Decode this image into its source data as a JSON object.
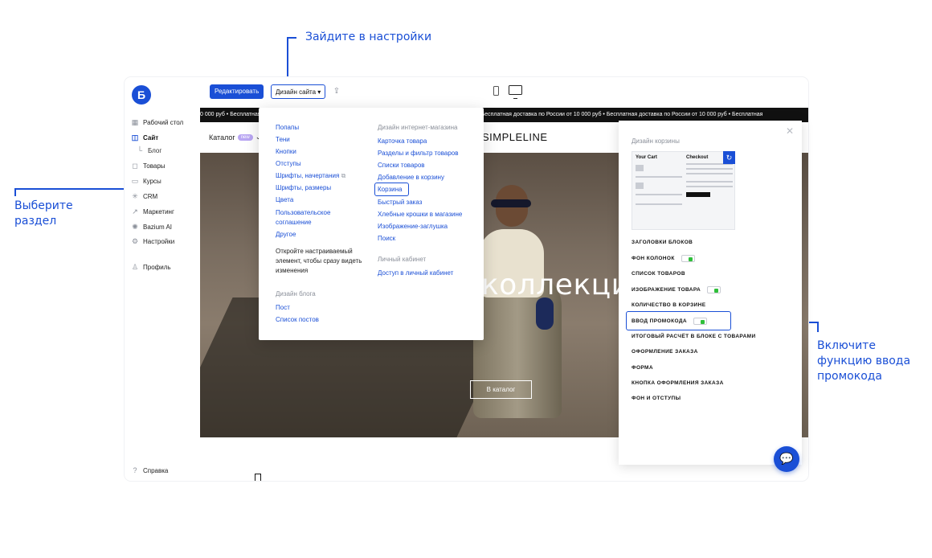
{
  "annotations": {
    "top": "Зайдите в настройки",
    "left": "Выберите раздел",
    "right": "Включите функцию ввода промокода"
  },
  "sidebar": {
    "logo": "Б",
    "items": [
      {
        "label": "Рабочий стол",
        "icon": "grid-icon"
      },
      {
        "label": "Сайт",
        "icon": "layout-icon"
      },
      {
        "label": "Блог",
        "icon": "corner-icon"
      },
      {
        "label": "Товары",
        "icon": "bag-icon"
      },
      {
        "label": "Курсы",
        "icon": "book-icon"
      },
      {
        "label": "CRM",
        "icon": "network-icon"
      },
      {
        "label": "Маркетинг",
        "icon": "chart-icon"
      },
      {
        "label": "Bazium AI",
        "icon": "sparkle-icon"
      },
      {
        "label": "Настройки",
        "icon": "gear-icon"
      },
      {
        "label": "Профиль",
        "icon": "user-icon"
      },
      {
        "label": "Справка",
        "icon": "help-icon"
      }
    ]
  },
  "toolbar": {
    "edit_label": "Редактировать",
    "design_label": "Дизайн сайта ▾"
  },
  "site": {
    "ticker": "0 000 руб   •   Бесплатная доставка по России от 10 000 руб   •   Бесплатная доставка по России от 10 000 руб   •   Бесплатная доставка по России от 10 000 руб   •   Бесплатная доставка по России от 10 000 руб   •   Бесплатная",
    "catalog": "Каталог",
    "badge": "new",
    "brand": "SIMPLELINE",
    "hero_title": "коллекция",
    "hero_button": "В каталог"
  },
  "dropdown": {
    "col1": [
      "Попапы",
      "Тени",
      "Кнопки",
      "Отступы",
      "Шрифты, начертания",
      "Шрифты, размеры",
      "Цвета",
      "Пользовательское соглашение",
      "Другое"
    ],
    "hint": "Откройте настраиваемый элемент, чтобы сразу видеть изменения",
    "blog_head": "Дизайн блога",
    "blog_items": [
      "Пост",
      "Список постов"
    ],
    "shop_head": "Дизайн интернет-магазина",
    "shop_items": [
      "Карточка товара",
      "Разделы и фильтр товаров",
      "Списки товаров",
      "Добавление в корзину",
      "Корзина",
      "Быстрый заказ",
      "Хлебные крошки в магазине",
      "Изображение-заглушка",
      "Поиск"
    ],
    "account_head": "Личный кабинет",
    "account_items": [
      "Доступ в личный кабинет"
    ]
  },
  "panel": {
    "title": "Дизайн корзины",
    "thumb_left": "Your Cart",
    "thumb_right": "Checkout",
    "rows": [
      {
        "label": "ЗАГОЛОВКИ БЛОКОВ",
        "toggle": false
      },
      {
        "label": "ФОН КОЛОНОК",
        "toggle": true
      },
      {
        "label": "СПИСОК ТОВАРОВ",
        "toggle": false
      },
      {
        "label": "ИЗОБРАЖЕНИЕ ТОВАРА",
        "toggle": true
      },
      {
        "label": "КОЛИЧЕСТВО В КОРЗИНЕ",
        "toggle": false
      },
      {
        "label": "ВВОД ПРОМОКОДА",
        "toggle": true
      },
      {
        "label": "ИТОГОВЫЙ РАСЧЁТ В БЛОКЕ С ТОВАРАМИ",
        "toggle": false
      },
      {
        "label": "ОФОРМЛЕНИЕ ЗАКАЗА",
        "toggle": false
      },
      {
        "label": "ФОРМА",
        "toggle": false
      },
      {
        "label": "КНОПКА ОФОРМЛЕНИЯ ЗАКАЗА",
        "toggle": false
      },
      {
        "label": "ФОН И ОТСТУПЫ",
        "toggle": false
      }
    ]
  },
  "colors": {
    "accent": "#1a4fd6",
    "toggle_on": "#2fbf3a"
  }
}
